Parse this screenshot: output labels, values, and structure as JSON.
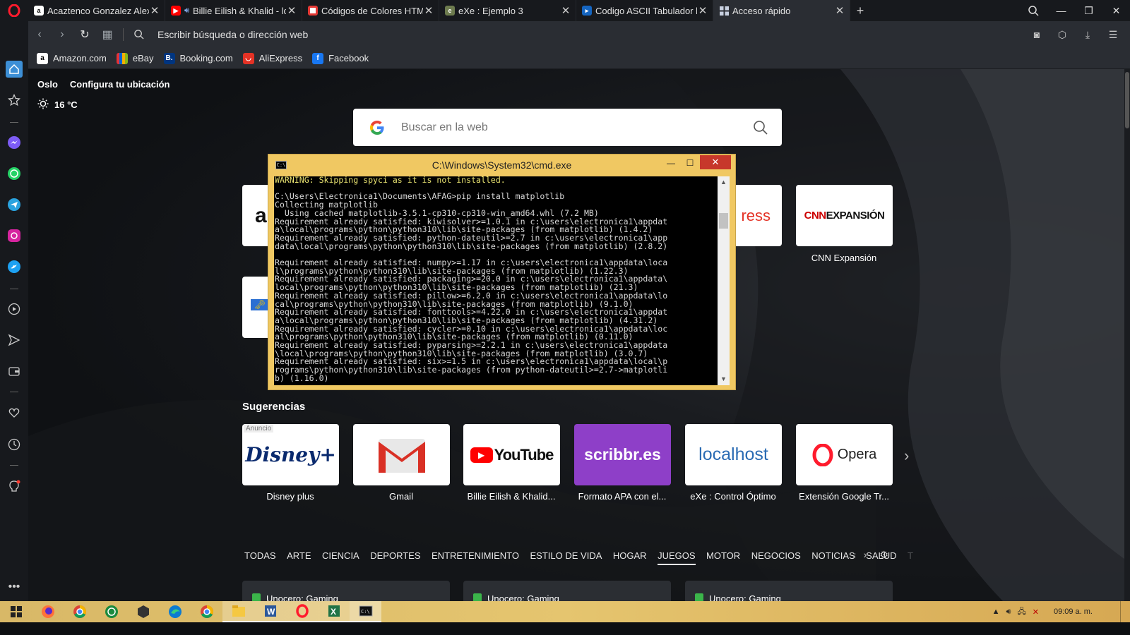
{
  "browser": {
    "tabs": [
      {
        "title": "Acaztenco Gonzalez Alexis",
        "favicon": "amazon-favicon",
        "color": "#232f3e",
        "active": false
      },
      {
        "title": "Billie Eilish & Khalid - lo",
        "favicon": "youtube-favicon",
        "color": "#ff0000",
        "active": false,
        "audio": true
      },
      {
        "title": "Códigos de Colores HTML",
        "favicon": "html-colors-favicon",
        "color": "#e53935",
        "active": false
      },
      {
        "title": "eXe : Ejemplo 3",
        "favicon": "exe-favicon",
        "color": "#6d7b4e",
        "active": false
      },
      {
        "title": "Codigo ASCII Tabulador ho",
        "favicon": "ascii-favicon",
        "color": "#1565c0",
        "active": false
      },
      {
        "title": "Acceso rápido",
        "favicon": "speed-dial-favicon",
        "color": "#9aa7c7",
        "active": true
      }
    ],
    "address_placeholder": "Escribir búsqueda o dirección web",
    "bookmarks": [
      {
        "label": "Amazon.com",
        "icon": "amazon-icon",
        "color": "#ffffff",
        "letter": "a"
      },
      {
        "label": "eBay",
        "icon": "ebay-icon",
        "color": "#e53238",
        "letter": "e"
      },
      {
        "label": "Booking.com",
        "icon": "booking-icon",
        "color": "#003580",
        "letter": "B."
      },
      {
        "label": "AliExpress",
        "icon": "aliexpress-icon",
        "color": "#e43225",
        "letter": "A"
      },
      {
        "label": "Facebook",
        "icon": "facebook-icon",
        "color": "#1877f2",
        "letter": "f"
      }
    ]
  },
  "weather": {
    "city": "Oslo",
    "configure": "Configura tu ubicación",
    "temperature": "16 °C"
  },
  "search": {
    "placeholder": "Buscar en la web"
  },
  "speed_dial": {
    "top_tiles": [
      {
        "label": "ress",
        "name": "AliExpress"
      },
      {
        "label": "CNN Expansión",
        "logo": "CNN EXPANSIÓN"
      }
    ]
  },
  "suggestions": {
    "title": "Sugerencias",
    "ad_badge": "Anuncio",
    "tiles": [
      {
        "label": "Disney plus",
        "logo": "Disney+"
      },
      {
        "label": "Gmail",
        "logo": "gmail-icon"
      },
      {
        "label": "Billie Eilish & Khalid...",
        "logo": "YouTube"
      },
      {
        "label": "Formato APA con el...",
        "logo": "scribbr.es"
      },
      {
        "label": "eXe : Control Óptimo",
        "logo": "localhost"
      },
      {
        "label": "Extensión Google Tr...",
        "logo": "Opera"
      }
    ]
  },
  "categories": {
    "items": [
      "TODAS",
      "ARTE",
      "CIENCIA",
      "DEPORTES",
      "ENTRETENIMIENTO",
      "ESTILO DE VIDA",
      "HOGAR",
      "JUEGOS",
      "MOTOR",
      "NEGOCIOS",
      "NOTICIAS",
      "SALUD",
      "T"
    ],
    "active": "JUEGOS"
  },
  "news": [
    {
      "source": "Unocero: Gaming"
    },
    {
      "source": "Unocero: Gaming"
    },
    {
      "source": "Unocero: Gaming"
    }
  ],
  "cmd": {
    "title": "C:\\Windows\\System32\\cmd.exe",
    "lines": [
      {
        "text": "WARNING: Skipping spyci as it is not installed.",
        "warn": true
      },
      {
        "text": ""
      },
      {
        "text": "C:\\Users\\Electronica1\\Documents\\AFAG>pip install matplotlib"
      },
      {
        "text": "Collecting matplotlib"
      },
      {
        "text": "  Using cached matplotlib-3.5.1-cp310-cp310-win_amd64.whl (7.2 MB)"
      },
      {
        "text": "Requirement already satisfied: kiwisolver>=1.0.1 in c:\\users\\electronica1\\appdat"
      },
      {
        "text": "a\\local\\programs\\python\\python310\\lib\\site-packages (from matplotlib) (1.4.2)"
      },
      {
        "text": "Requirement already satisfied: python-dateutil>=2.7 in c:\\users\\electronica1\\app"
      },
      {
        "text": "data\\local\\programs\\python\\python310\\lib\\site-packages (from matplotlib) (2.8.2)"
      },
      {
        "text": ""
      },
      {
        "text": "Requirement already satisfied: numpy>=1.17 in c:\\users\\electronica1\\appdata\\loca"
      },
      {
        "text": "l\\programs\\python\\python310\\lib\\site-packages (from matplotlib) (1.22.3)"
      },
      {
        "text": "Requirement already satisfied: packaging>=20.0 in c:\\users\\electronica1\\appdata\\"
      },
      {
        "text": "local\\programs\\python\\python310\\lib\\site-packages (from matplotlib) (21.3)"
      },
      {
        "text": "Requirement already satisfied: pillow>=6.2.0 in c:\\users\\electronica1\\appdata\\lo"
      },
      {
        "text": "cal\\programs\\python\\python310\\lib\\site-packages (from matplotlib) (9.1.0)"
      },
      {
        "text": "Requirement already satisfied: fonttools>=4.22.0 in c:\\users\\electronica1\\appdat"
      },
      {
        "text": "a\\local\\programs\\python\\python310\\lib\\site-packages (from matplotlib) (4.31.2)"
      },
      {
        "text": "Requirement already satisfied: cycler>=0.10 in c:\\users\\electronica1\\appdata\\loc"
      },
      {
        "text": "al\\programs\\python\\python310\\lib\\site-packages (from matplotlib) (0.11.0)"
      },
      {
        "text": "Requirement already satisfied: pyparsing>=2.2.1 in c:\\users\\electronica1\\appdata"
      },
      {
        "text": "\\local\\programs\\python\\python310\\lib\\site-packages (from matplotlib) (3.0.7)"
      },
      {
        "text": "Requirement already satisfied: six>=1.5 in c:\\users\\electronica1\\appdata\\local\\p"
      },
      {
        "text": "rograms\\python\\python310\\lib\\site-packages (from python-dateutil>=2.7->matplotli"
      },
      {
        "text": "b) (1.16.0)"
      }
    ]
  },
  "taskbar": {
    "apps": [
      "start-icon",
      "firefox-icon",
      "chrome-icon",
      "whatsapp-icon",
      "app-icon",
      "edge-icon",
      "chrome-icon",
      "file-explorer-icon",
      "word-icon",
      "opera-icon",
      "excel-icon",
      "cmd-icon"
    ],
    "clock": "09:09 a. m."
  },
  "colors": {
    "accent": "#ff1b2d",
    "taskbar": "#e5c56f",
    "cmd_border": "#f0c862"
  }
}
